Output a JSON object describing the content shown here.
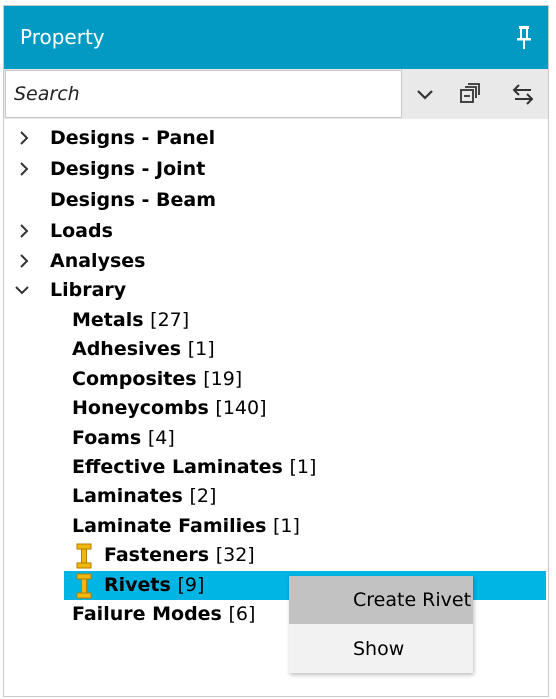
{
  "header": {
    "title": "Property"
  },
  "search": {
    "placeholder": "Search"
  },
  "icons": {
    "pin": "pin-icon",
    "dropdown": "chevron-down-icon",
    "collapse_all": "collapse-all-icon",
    "sync": "sync-arrows-icon",
    "fastener": "fastener-bolt-icon"
  },
  "colors": {
    "titlebar": "#0299c2",
    "selection": "#00b4e4",
    "fastener_icon": "#f2b80f",
    "context_highlight": "#c2c2c2"
  },
  "tree": {
    "designs_panel": "Designs - Panel",
    "designs_joint": "Designs - Joint",
    "designs_beam": "Designs - Beam",
    "loads": "Loads",
    "analyses": "Analyses",
    "library": "Library",
    "library_items": [
      {
        "label": "Metals",
        "count": "[27]"
      },
      {
        "label": "Adhesives",
        "count": "[1]"
      },
      {
        "label": "Composites",
        "count": "[19]"
      },
      {
        "label": "Honeycombs",
        "count": "[140]"
      },
      {
        "label": "Foams",
        "count": "[4]"
      },
      {
        "label": "Effective Laminates",
        "count": "[1]"
      },
      {
        "label": "Laminates",
        "count": "[2]"
      },
      {
        "label": "Laminate Families",
        "count": "[1]"
      },
      {
        "label": "Fasteners",
        "count": "[32]"
      },
      {
        "label": "Rivets",
        "count": "[9]"
      },
      {
        "label": "Failure Modes",
        "count": "[6]"
      }
    ]
  },
  "context_menu": {
    "items": [
      "Create Rivet",
      "Show"
    ]
  }
}
